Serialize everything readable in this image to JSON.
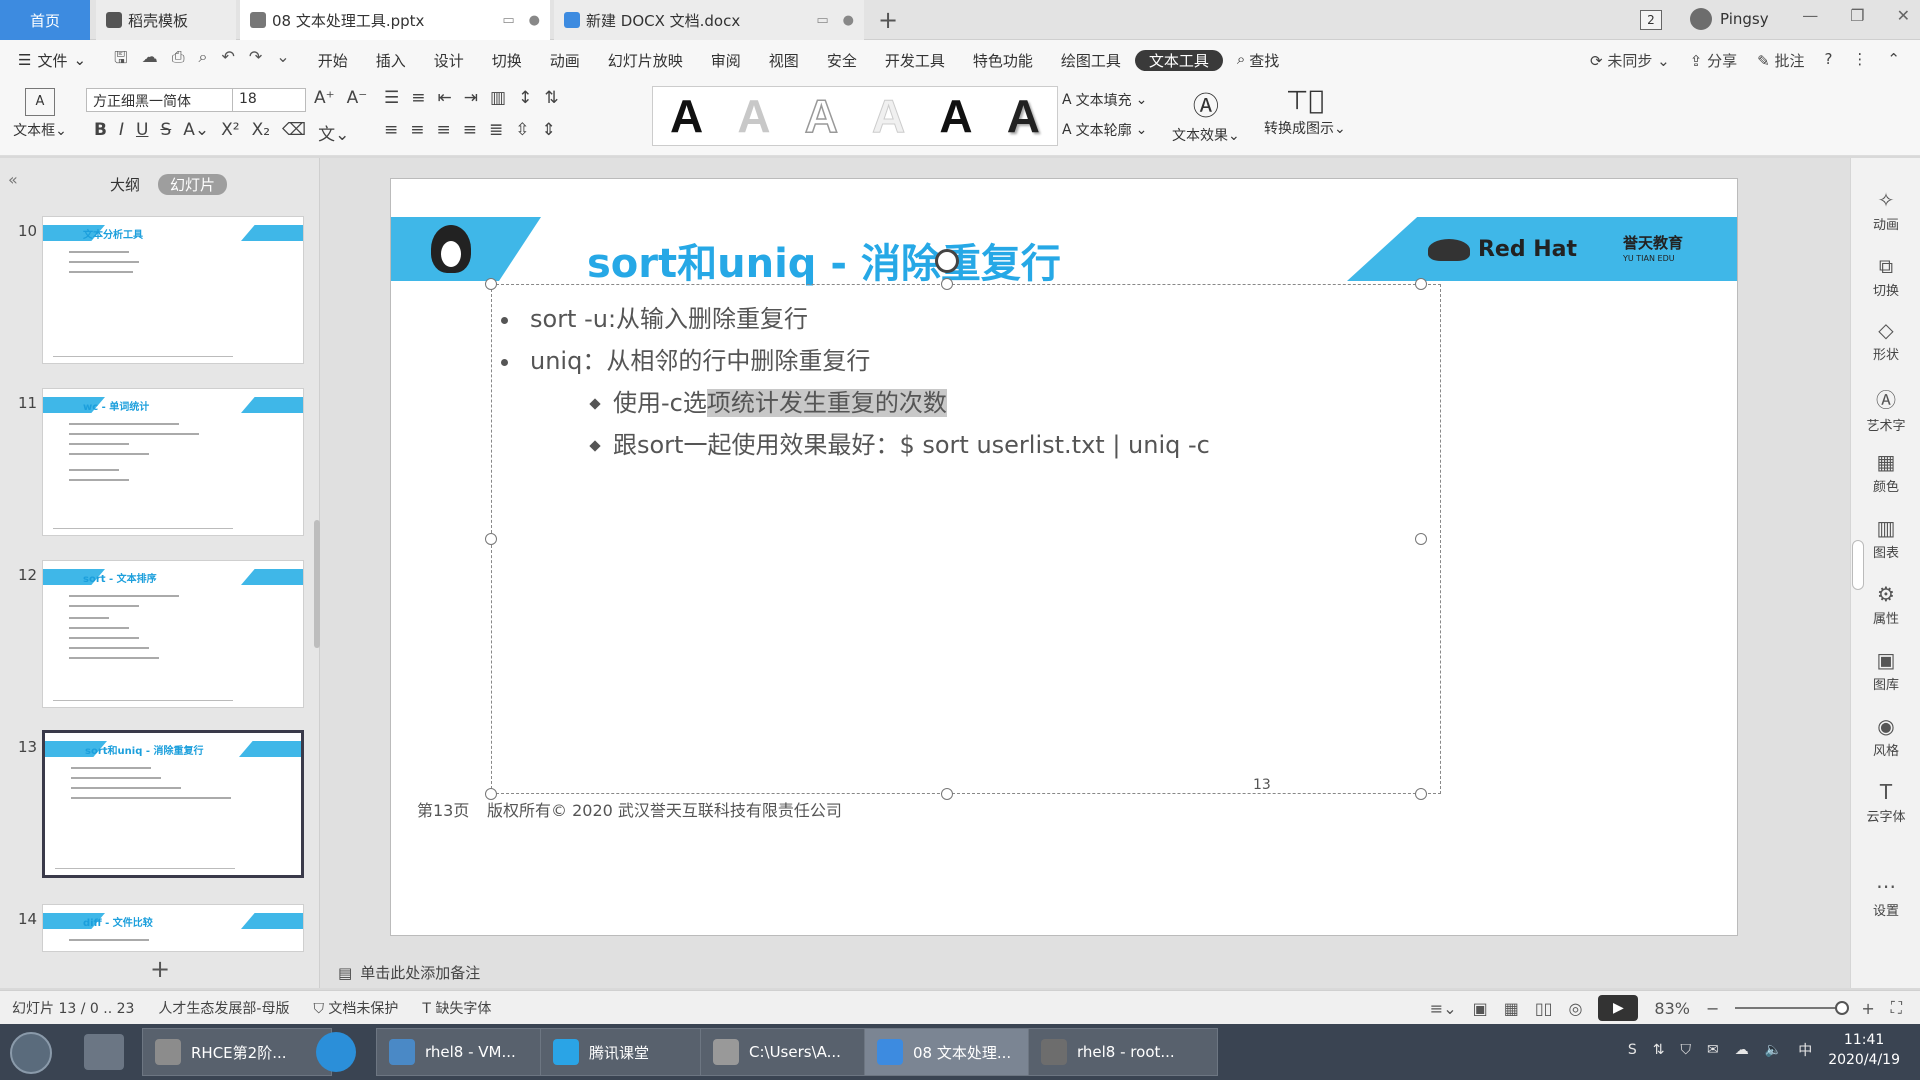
{
  "tabs": {
    "home": "首页",
    "template": "稻壳模板",
    "pptx": "08 文本处理工具.pptx",
    "docx": "新建 DOCX 文档.docx",
    "window_count": "2",
    "user": "Pingsy"
  },
  "menu": {
    "file": "文件",
    "items": [
      "开始",
      "插入",
      "设计",
      "切换",
      "动画",
      "幻灯片放映",
      "审阅",
      "视图",
      "安全",
      "开发工具",
      "特色功能",
      "绘图工具"
    ],
    "active": "文本工具",
    "search": "查找",
    "sync": "未同步",
    "share": "分享",
    "comment": "批注"
  },
  "ribbon": {
    "textbox": "文本框",
    "font_name": "方正细黑一简体",
    "font_size": "18",
    "text_fill": "文本填充",
    "text_outline": "文本轮廓",
    "text_effect": "文本效果",
    "convert": "转换成图示"
  },
  "left_panel": {
    "tab_outline": "大纲",
    "tab_slides": "幻灯片",
    "thumbnails": [
      {
        "num": "10",
        "title": "文本分析工具"
      },
      {
        "num": "11",
        "title": "wc - 单词统计"
      },
      {
        "num": "12",
        "title": "sort - 文本排序"
      },
      {
        "num": "13",
        "title": "sort和uniq - 消除重复行"
      },
      {
        "num": "14",
        "title": "diff - 文件比较"
      }
    ]
  },
  "slide": {
    "title": "sort和uniq - 消除重复行",
    "logo_redhat": "Red Hat",
    "logo_yutian": "誉天教育",
    "logo_yutian_en": "YU TIAN EDU",
    "bullet1": "sort -u:从输入删除重复行",
    "bullet2": "uniq：从相邻的行中删除重复行",
    "sub1_plain": "使用-c选",
    "sub1_hl": "项统计发生重复的次数",
    "sub2": "跟sort一起使用效果最好：$ sort userlist.txt | uniq -c",
    "footer_page": "第13页",
    "footer_copy": "版权所有© 2020 武汉誉天互联科技有限责任公司",
    "page_number": "13"
  },
  "right_sidebar": [
    "动画",
    "切换",
    "形状",
    "艺术字",
    "颜色",
    "图表",
    "属性",
    "图库",
    "风格",
    "云字体",
    "设置"
  ],
  "notes": "单击此处添加备注",
  "status": {
    "slide_pos": "幻灯片 13 / 0 .. 23",
    "template": "人才生态发展部-母版",
    "protect": "文档未保护",
    "missing_font": "缺失字体",
    "zoom": "83%"
  },
  "taskbar": {
    "items": [
      "RHCE第2阶...",
      "rhel8 - VM...",
      "腾讯课堂",
      "C:\\Users\\A...",
      "08 文本处理...",
      "rhel8 - root..."
    ],
    "time": "11:41",
    "date": "2020/4/19"
  },
  "colors": {
    "accent_blue": "#3fb7e8",
    "title_blue": "#26a8e6",
    "home_tab": "#3d8be0"
  }
}
